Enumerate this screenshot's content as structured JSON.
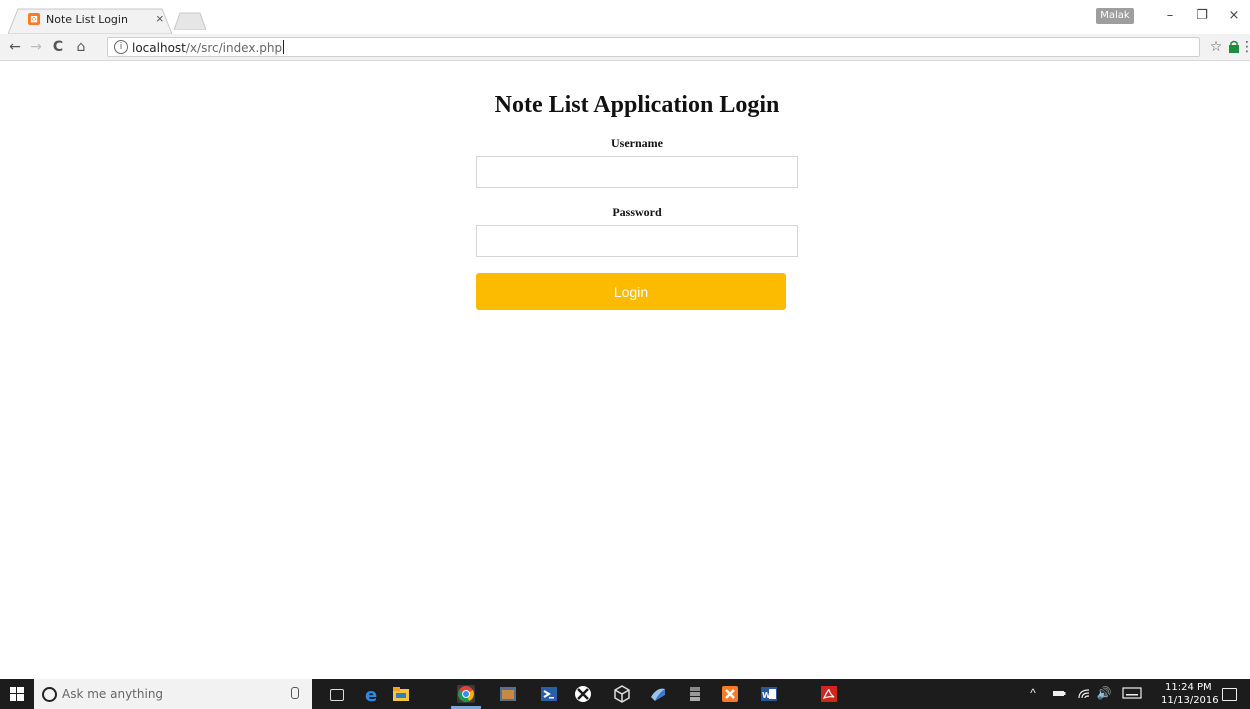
{
  "browser": {
    "tab_title": "Note List Login",
    "tab_close": "×",
    "profile_name": "Malak",
    "window_controls": {
      "minimize": "–",
      "restore": "❐",
      "close": "×"
    },
    "nav": {
      "back": "←",
      "forward": "→",
      "reload": "C",
      "home": "⌂"
    },
    "address": {
      "host": "localhost",
      "path": "/x/src/index.php",
      "info": "i"
    },
    "toolbar_right": {
      "bookmark": "☆",
      "menu": "⋮"
    }
  },
  "page": {
    "title": "Note List Application Login",
    "username_label": "Username",
    "username_value": "",
    "password_label": "Password",
    "password_value": "",
    "login_button": "Login",
    "button_color": "#fdbb00"
  },
  "taskbar": {
    "search_placeholder": "Ask me anything",
    "apps": [
      "task-view",
      "edge",
      "file-explorer",
      "chrome",
      "app-5",
      "powershell",
      "xbox",
      "app-vr",
      "visual-studio",
      "database",
      "xampp",
      "word",
      "acrobat"
    ],
    "tray": {
      "chevron": "^",
      "volume": "🔊"
    },
    "clock_time": "11:24 PM",
    "clock_date": "11/13/2016"
  }
}
